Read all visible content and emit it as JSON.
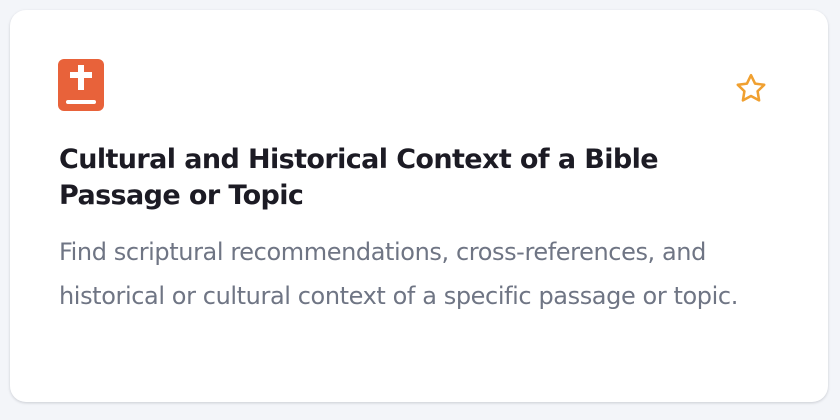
{
  "card": {
    "icon": "bible-icon",
    "icon_color": "#e8623a",
    "favorite_icon": "star-outline-icon",
    "favorite_color": "#f0a030",
    "title": "Cultural and Historical Context of a Bible Passage or Topic",
    "description": "Find scriptural recommendations, cross-references, and historical or cultural context of a specific passage or topic."
  }
}
